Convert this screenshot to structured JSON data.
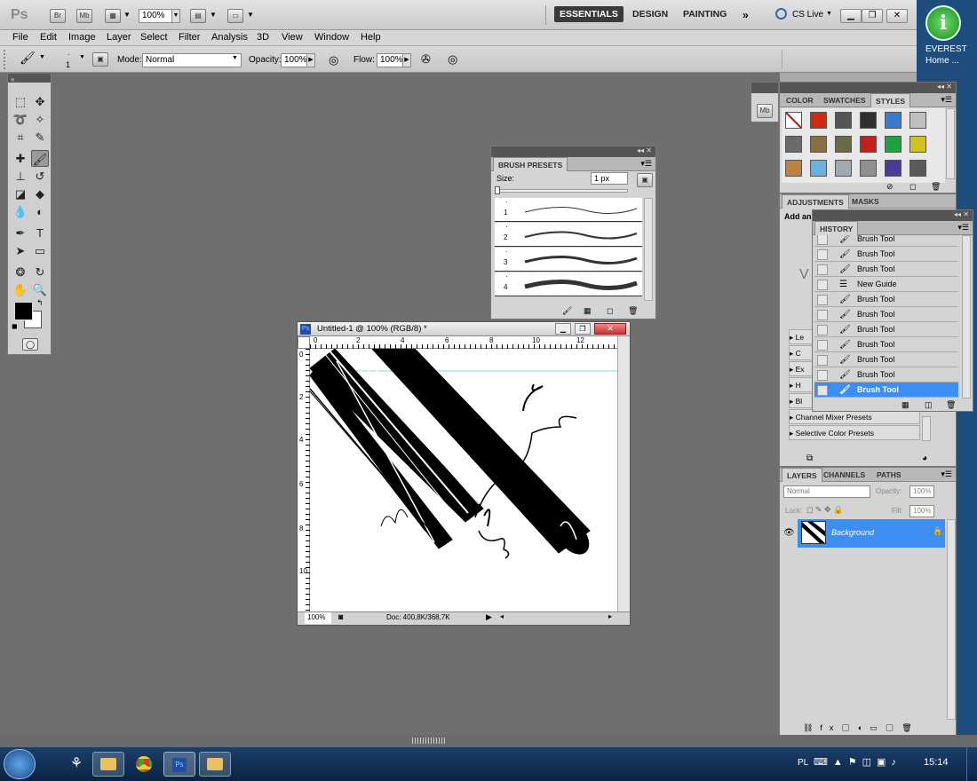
{
  "appbar": {
    "logo": "Ps",
    "bridge": "Br",
    "minibridge": "Mb",
    "zoom": "100%",
    "workspaces": [
      "ESSENTIALS",
      "DESIGN",
      "PAINTING"
    ],
    "more_icon": "double-chevron-right-icon",
    "cslive": "CS Live"
  },
  "menu": [
    "File",
    "Edit",
    "Image",
    "Layer",
    "Select",
    "Filter",
    "Analysis",
    "3D",
    "View",
    "Window",
    "Help"
  ],
  "options": {
    "brush_size": "1",
    "mode_label": "Mode:",
    "mode_value": "Normal",
    "opacity_label": "Opacity:",
    "opacity_value": "100%",
    "flow_label": "Flow:",
    "flow_value": "100%"
  },
  "styles_panel": {
    "tabs": [
      "COLOR",
      "SWATCHES",
      "STYLES"
    ],
    "swatch_colors": [
      "#ffffff",
      "#d02a10",
      "#555555",
      "#303030",
      "#3a7ad0",
      "#c0c0c0",
      "#6a6a6a",
      "#8a7040",
      "#6a6a4a",
      "#c02020",
      "#20a040",
      "#d0c020",
      "#c08040",
      "#6ab0e0",
      "#a0a8b0",
      "#909090",
      "#4a3a9a",
      "#5a5a5a"
    ]
  },
  "adjust_panel": {
    "tabs": [
      "ADJUSTMENTS",
      "MASKS"
    ],
    "title": "Add an",
    "items": [
      "Le",
      "C",
      "Ex",
      "H",
      "Bl",
      "Channel Mixer Presets",
      "Selective Color Presets"
    ]
  },
  "history_panel": {
    "tab": "HISTORY",
    "rows": [
      "Brush Tool",
      "Brush Tool",
      "Brush Tool",
      "New Guide",
      "Brush Tool",
      "Brush Tool",
      "Brush Tool",
      "Brush Tool",
      "Brush Tool",
      "Brush Tool",
      "Brush Tool"
    ],
    "selected_index": 10
  },
  "brush_presets": {
    "tab": "BRUSH PRESETS",
    "size_label": "Size:",
    "size_value": "1 px",
    "presets": [
      "1",
      "2",
      "3",
      "4"
    ]
  },
  "layers_panel": {
    "tabs": [
      "LAYERS",
      "CHANNELS",
      "PATHS"
    ],
    "blend": "Normal",
    "opacity_label": "Opacity:",
    "opacity_value": "100%",
    "lock_label": "Lock:",
    "fill_label": "Fill:",
    "fill_value": "100%",
    "layer_name": "Background"
  },
  "document": {
    "title": "Untitled-1 @ 100% (RGB/8) *",
    "zoom": "100%",
    "doc_info": "Doc: 400,8K/368,7K",
    "ruler_h": [
      "0",
      "2",
      "4",
      "6",
      "8",
      "10",
      "12"
    ],
    "ruler_v": [
      "0",
      "2",
      "4",
      "6",
      "8",
      "10"
    ]
  },
  "desktop": {
    "icon_label_1": "EVEREST",
    "icon_label_2": "Home ..."
  },
  "taskbar": {
    "language": "PL",
    "clock": "15:14"
  }
}
